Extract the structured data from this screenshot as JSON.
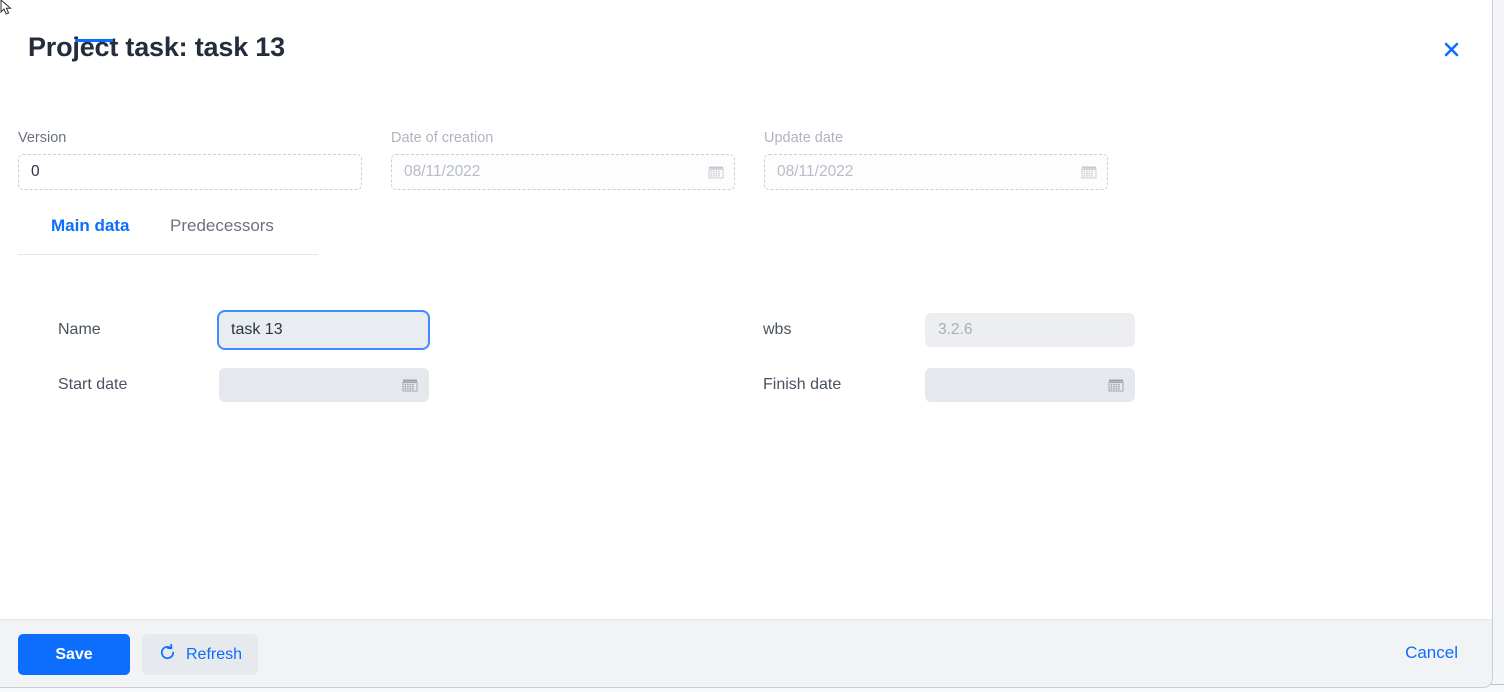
{
  "dialog": {
    "title": "Project task: task 13",
    "close_icon": "close-icon"
  },
  "top_fields": [
    {
      "label": "Version",
      "value": "0",
      "placeholder": "",
      "disabled": false,
      "has_calendar": false
    },
    {
      "label": "Date of creation",
      "value": "08/11/2022",
      "placeholder": "08/11/2022",
      "disabled": true,
      "has_calendar": true
    },
    {
      "label": "Update date",
      "value": "08/11/2022",
      "placeholder": "08/11/2022",
      "disabled": true,
      "has_calendar": true
    }
  ],
  "tabs": [
    {
      "label": "Main data",
      "active": true
    },
    {
      "label": "Predecessors",
      "active": false
    }
  ],
  "main_data": {
    "name": {
      "label": "Name",
      "value": "task 13",
      "focused": true
    },
    "wbs": {
      "label": "wbs",
      "value": "3.2.6",
      "disabled": true
    },
    "start_date": {
      "label": "Start date",
      "value": "",
      "disabled": true,
      "has_calendar": true
    },
    "finish_date": {
      "label": "Finish date",
      "value": "",
      "disabled": true,
      "has_calendar": true
    }
  },
  "footer": {
    "save_label": "Save",
    "refresh_label": "Refresh",
    "refresh_icon": "refresh-icon",
    "cancel_label": "Cancel"
  },
  "colors": {
    "accent": "#0d6efd",
    "title": "#242c3d",
    "label": "#6b7380",
    "disabled_text": "#b7bdc8",
    "field_fill": "#eceef1",
    "footer_bg": "#f1f3f5"
  }
}
